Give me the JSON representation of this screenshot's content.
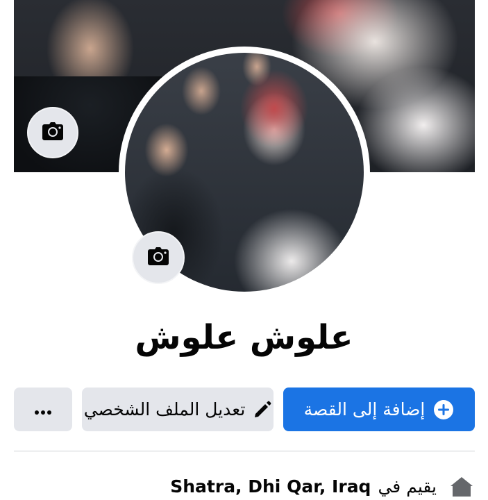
{
  "profile": {
    "name": "علوش علوش"
  },
  "actions": {
    "add_story_label": "إضافة إلى القصة",
    "edit_profile_label": "تعديل الملف الشخصي",
    "more_label": "•••"
  },
  "intro": {
    "lives_in_prefix": "يقيم في",
    "place": "Shatra, Dhi Qar, Iraq"
  },
  "icons": {
    "cover_camera": "camera-icon",
    "avatar_camera": "camera-icon",
    "add_story": "plus-circle-icon",
    "edit": "pencil-icon",
    "more": "ellipsis-icon",
    "home": "home-icon"
  },
  "colors": {
    "primary": "#1b74e4",
    "secondary_button": "#e4e6eb",
    "text": "#050505"
  }
}
